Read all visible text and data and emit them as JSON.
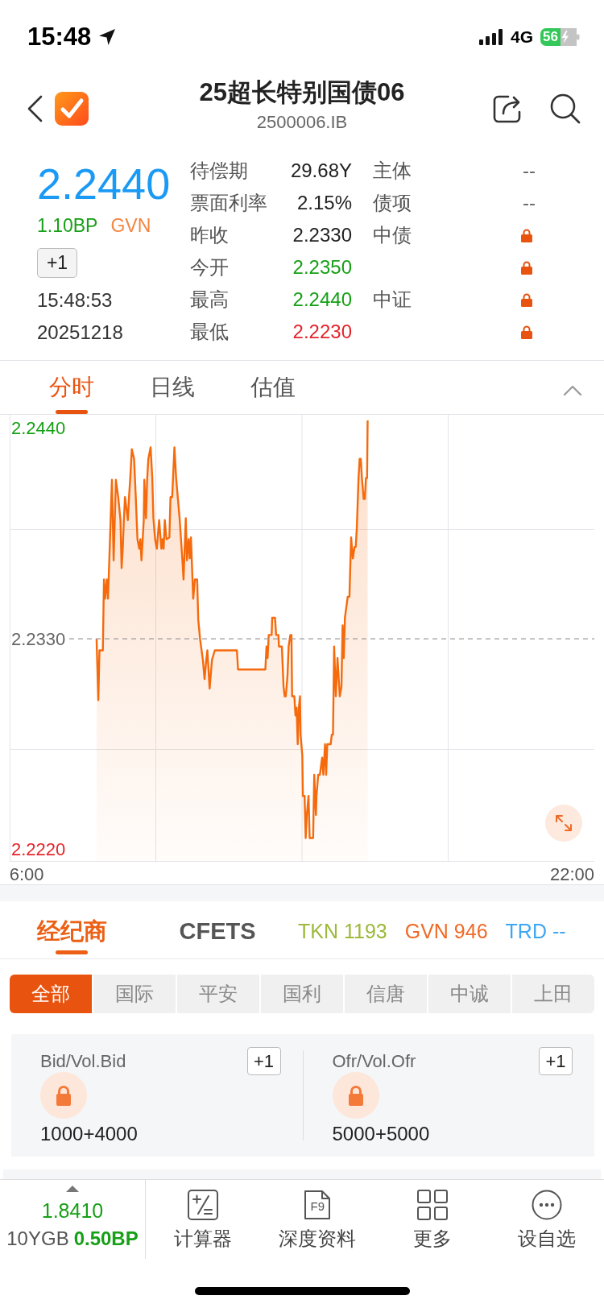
{
  "status_bar": {
    "time": "15:48",
    "network": "4G",
    "battery": "56"
  },
  "header": {
    "title": "25超长特别国债06",
    "code": "2500006.IB"
  },
  "quote": {
    "price": "2.2440",
    "change": "1.10BP",
    "source": "GVN",
    "add_button": "+1",
    "time": "15:48:53",
    "date": "20251218"
  },
  "stats": [
    {
      "label": "待偿期",
      "value": "29.68Y",
      "color": "#222222",
      "side_label": "主体",
      "side_value": "--",
      "locked": false
    },
    {
      "label": "票面利率",
      "value": "2.15%",
      "color": "#222222",
      "side_label": "债项",
      "side_value": "--",
      "locked": false
    },
    {
      "label": "昨收",
      "value": "2.2330",
      "color": "#222222",
      "side_label": "中债",
      "locked": true
    },
    {
      "label": "今开",
      "value": "2.2350",
      "color": "#16a016",
      "locked": true
    },
    {
      "label": "最高",
      "value": "2.2440",
      "color": "#16a016",
      "side_label": "中证",
      "locked": true
    },
    {
      "label": "最低",
      "value": "2.2230",
      "color": "#e5242b",
      "locked": true
    }
  ],
  "chart_tabs": [
    {
      "label": "分时",
      "selected": true
    },
    {
      "label": "日线",
      "selected": false
    },
    {
      "label": "估值",
      "selected": false
    }
  ],
  "chart": {
    "chart_data": {
      "type": "line",
      "x": [
        483,
        486,
        488,
        494,
        496,
        498,
        501,
        503,
        506,
        510,
        513,
        517,
        521,
        525,
        527,
        529,
        531,
        533,
        538,
        540,
        542,
        545,
        549,
        552,
        555,
        558,
        560,
        562,
        566,
        567,
        570,
        572,
        574,
        578,
        581,
        583,
        586,
        589,
        593,
        597,
        599,
        601,
        603,
        606,
        611,
        613,
        616,
        620,
        623,
        629,
        634,
        636,
        640,
        642,
        645,
        647,
        649,
        653,
        656,
        660,
        662,
        665,
        670,
        673,
        676,
        678,
        682,
        686,
        691,
        730,
        732,
        780,
        782,
        784,
        786,
        791,
        792,
        797,
        799,
        803,
        804,
        809,
        812,
        814,
        816,
        819,
        821,
        824,
        826,
        827,
        831,
        833,
        835,
        837,
        839,
        841,
        842,
        845,
        846,
        849,
        851,
        853,
        856,
        858,
        860,
        864,
        866,
        869,
        870,
        873,
        876,
        880,
        882,
        885,
        887,
        889,
        895,
        897,
        899,
        901,
        904,
        907,
        910,
        911,
        914,
        916,
        918,
        920,
        925,
        928,
        931,
        934,
        937,
        939,
        941,
        944,
        946,
        948,
        950,
        953,
        955,
        957,
        959,
        960
      ],
      "series": [
        {
          "color": "#f56a0c",
          "values": [
            2.233,
            2.2298,
            2.2324,
            2.2324,
            2.2361,
            2.2351,
            2.2361,
            2.2351,
            2.2377,
            2.2413,
            2.2371,
            2.2413,
            2.2404,
            2.2392,
            2.2367,
            2.2377,
            2.2392,
            2.2404,
            2.2392,
            2.2404,
            2.2413,
            2.2429,
            2.2424,
            2.2404,
            2.2382,
            2.2377,
            2.2382,
            2.2371,
            2.2392,
            2.2413,
            2.2393,
            2.2413,
            2.2424,
            2.243,
            2.2414,
            2.2393,
            2.2382,
            2.2377,
            2.2392,
            2.2377,
            2.2382,
            2.2377,
            2.2392,
            2.2382,
            2.2383,
            2.2404,
            2.2404,
            2.243,
            2.2414,
            2.2393,
            2.2371,
            2.2361,
            2.2393,
            2.2371,
            2.2382,
            2.2372,
            2.2383,
            2.2351,
            2.2361,
            2.2361,
            2.234,
            2.233,
            2.2319,
            2.2309,
            2.2319,
            2.2324,
            2.2304,
            2.2319,
            2.2324,
            2.2324,
            2.2314,
            2.2314,
            2.2326,
            2.232,
            2.2332,
            2.2332,
            2.2341,
            2.2341,
            2.2332,
            2.2332,
            2.2326,
            2.2326,
            2.2305,
            2.23,
            2.23,
            2.2311,
            2.2326,
            2.2332,
            2.2332,
            2.23,
            2.23,
            2.229,
            2.2294,
            2.2275,
            2.2294,
            2.23,
            2.228,
            2.2269,
            2.2248,
            2.2248,
            2.2226,
            2.2238,
            2.2248,
            2.2226,
            2.2226,
            2.2226,
            2.2259,
            2.2238,
            2.2248,
            2.2259,
            2.2259,
            2.2268,
            2.2259,
            2.2275,
            2.2259,
            2.2275,
            2.2275,
            2.228,
            2.228,
            2.2326,
            2.23,
            2.232,
            2.2305,
            2.23,
            2.2305,
            2.2337,
            2.232,
            2.2341,
            2.2352,
            2.2352,
            2.2383,
            2.2372,
            2.2378,
            2.2378,
            2.2388,
            2.2414,
            2.2424,
            2.2424,
            2.2414,
            2.2403,
            2.2403,
            2.2414,
            2.2414,
            2.2444
          ]
        }
      ],
      "xlim": [
        330,
        1359
      ],
      "ylim": [
        2.2214,
        2.2447
      ],
      "xticks": [
        {
          "value": 360,
          "label": "6:00"
        },
        {
          "value": 1320,
          "label": "22:00"
        }
      ],
      "yticks": [
        {
          "value": 2.244,
          "label": "2.2440"
        },
        {
          "value": 2.222,
          "label": "2.2220"
        }
      ],
      "ref_lines": [
        {
          "axis": "y",
          "value": 2.233,
          "label": "2.2330"
        }
      ]
    }
  },
  "broker_tabs": [
    {
      "label": "经纪商",
      "selected": true
    },
    {
      "label": "CFETS",
      "selected": false
    }
  ],
  "quote_tags": [
    {
      "label": "TKN 1193",
      "color": "#9cb93b"
    },
    {
      "label": "GVN 946",
      "color": "#f06a26"
    },
    {
      "label": "TRD --",
      "color": "#3ea6f3"
    }
  ],
  "brokers": [
    {
      "label": "全部",
      "selected": true
    },
    {
      "label": "国际",
      "selected": false
    },
    {
      "label": "平安",
      "selected": false
    },
    {
      "label": "国利",
      "selected": false
    },
    {
      "label": "信唐",
      "selected": false
    },
    {
      "label": "中诚",
      "selected": false
    },
    {
      "label": "上田",
      "selected": false
    }
  ],
  "order_book": [
    {
      "label": "Bid/Vol.Bid",
      "add_button": "+1",
      "locked": true,
      "volume": "1000+4000"
    },
    {
      "label": "Ofr/Vol.Ofr",
      "add_button": "+1",
      "locked": true,
      "volume": "5000+5000"
    }
  ],
  "benchmark": {
    "value": "1.8410",
    "name": "10YGB",
    "change": "0.50BP"
  },
  "toolbar": [
    {
      "kind": "calculator",
      "label": "计算器"
    },
    {
      "kind": "document",
      "icon_text": "F9",
      "label": "深度资料"
    },
    {
      "kind": "grid",
      "label": "更多"
    },
    {
      "kind": "dots",
      "label": "设自选"
    }
  ]
}
